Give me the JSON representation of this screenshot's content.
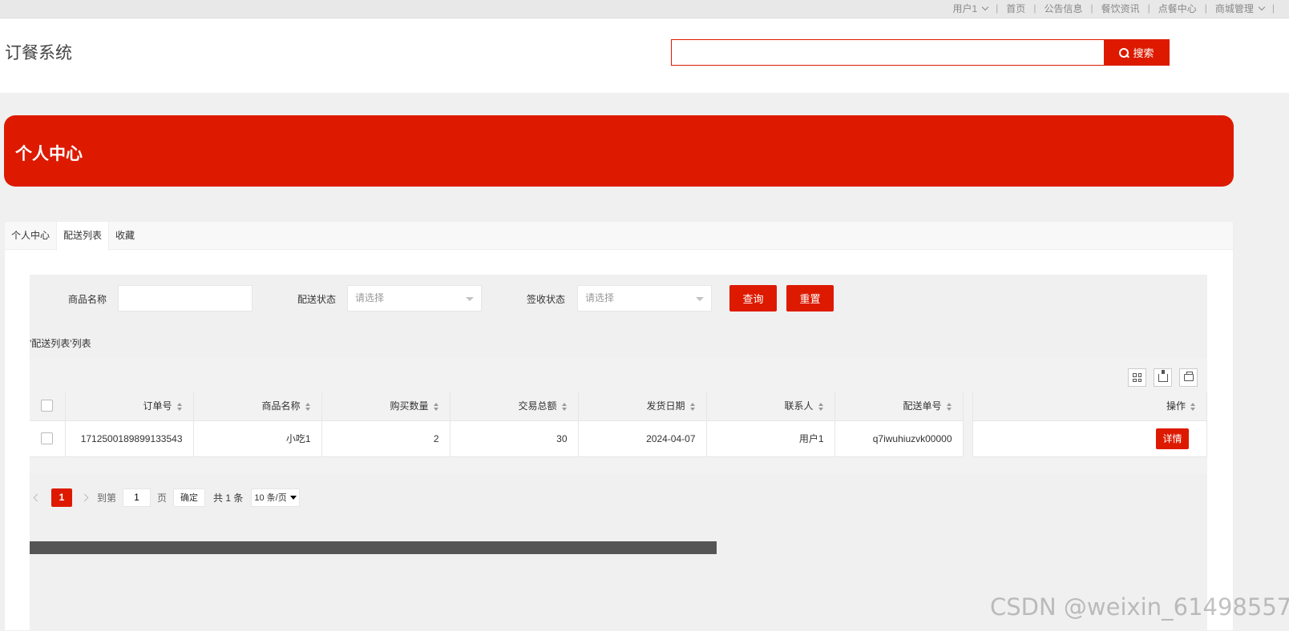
{
  "topnav": {
    "user": "用户1",
    "home": "首页",
    "notice": "公告信息",
    "food_news": "餐饮资讯",
    "order_center": "点餐中心",
    "mall": "商城管理"
  },
  "header": {
    "logo": "订餐系统",
    "search_placeholder": "",
    "search_label": "搜索"
  },
  "banner": {
    "title": "个人中心"
  },
  "tabs": [
    "个人中心",
    "配送列表",
    "收藏"
  ],
  "filters": {
    "product_name_label": "商品名称",
    "product_name_value": "",
    "delivery_status_label": "配送状态",
    "delivery_status_value": "请选择",
    "receipt_status_label": "签收状态",
    "receipt_status_value": "请选择",
    "query_label": "查询",
    "reset_label": "重置"
  },
  "list_caption": "'配送列表'列表",
  "table": {
    "headers": [
      "订单号",
      "商品名称",
      "购买数量",
      "交易总额",
      "发货日期",
      "联系人",
      "配送单号"
    ],
    "op_header": "操作",
    "rows": [
      [
        "1712500189899133543",
        "小吃1",
        "2",
        "30",
        "2024-04-07",
        "用户1",
        "q7iwuhiuzvk00000"
      ]
    ],
    "detail_label": "详情"
  },
  "pagination": {
    "current": "1",
    "goto_label": "到第",
    "goto_value": "1",
    "page_label": "页",
    "confirm_label": "确定",
    "total": "共 1 条",
    "page_size": "10 条/页"
  },
  "watermark": "CSDN @weixin_61498557",
  "colors": {
    "accent": "#dd1a00"
  }
}
